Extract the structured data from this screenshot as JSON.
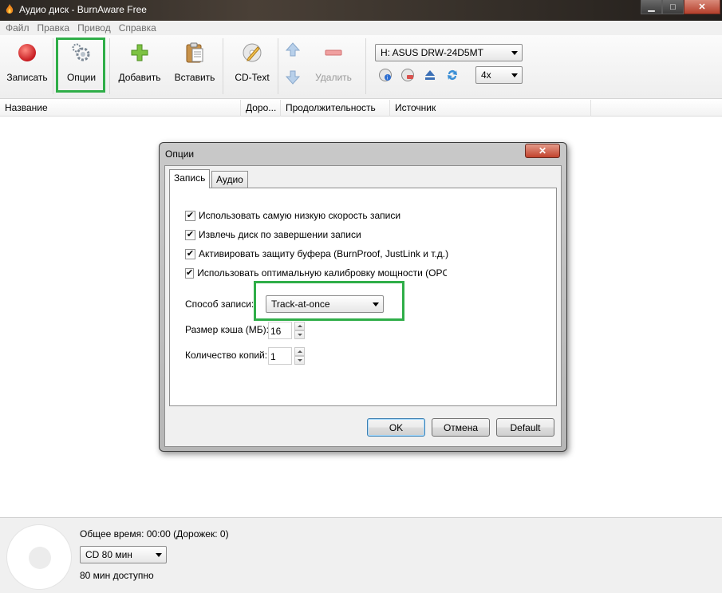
{
  "window": {
    "title": "Аудио диск - BurnAware Free"
  },
  "menu": [
    "Файл",
    "Правка",
    "Привод",
    "Справка"
  ],
  "toolbar": {
    "burn_label": "Записать",
    "options_label": "Опции",
    "add_label": "Добавить",
    "paste_label": "Вставить",
    "cdtext_label": "CD-Text",
    "remove_label": "Удалить",
    "drive_value": "H: ASUS DRW-24D5MT",
    "speed_value": "4x"
  },
  "list": {
    "columns": [
      "Название",
      "Доро...",
      "Продолжительность",
      "Источник"
    ]
  },
  "dialog": {
    "title": "Опции",
    "close_glyph": "✕",
    "tabs": [
      "Запись",
      "Аудио"
    ],
    "checkboxes": [
      {
        "label": "Использовать самую низкую скорость записи",
        "checked": true
      },
      {
        "label": "Извлечь диск по завершении записи",
        "checked": true
      },
      {
        "label": "Активировать защиту буфера (BurnProof, JustLink и т.д.)",
        "checked": true
      },
      {
        "label": "Использовать оптимальную калибровку мощности (OPC",
        "checked": true
      }
    ],
    "write_mode_label": "Способ записи:",
    "write_mode_value": "Track-at-once",
    "cache_label": "Размер кэша (МБ):",
    "cache_value": "16",
    "copies_label": "Количество копий:",
    "copies_value": "1",
    "ok_label": "OK",
    "cancel_label": "Отмена",
    "default_label": "Default"
  },
  "status": {
    "total_time": "Общее время: 00:00 (Дорожек: 0)",
    "disc_type": "CD 80 мин",
    "available": "80 мин доступно"
  },
  "colors": {
    "highlight": "#2fae48",
    "record_red": "#d9262b",
    "add_green": "#7dc242"
  }
}
